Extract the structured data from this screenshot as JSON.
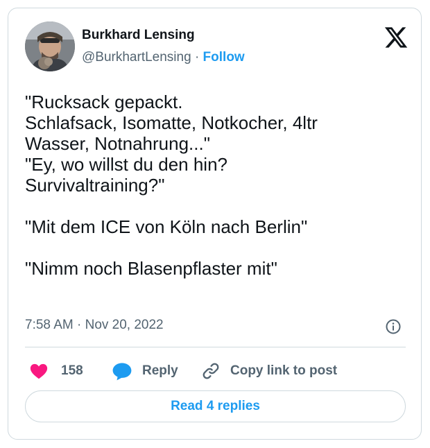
{
  "author": {
    "name": "Burkhard Lensing",
    "handle": "@BurkhartLensing",
    "separator": "·",
    "follow_label": "Follow"
  },
  "tweet": {
    "text": "\"Rucksack gepackt.\nSchlafsack, Isomatte, Notkocher, 4ltr\nWasser, Notnahrung...\"\n\"Ey, wo willst du den hin?\nSurvivaltraining?\"\n\n\"Mit dem ICE von Köln nach Berlin\"\n\n\"Nimm noch Blasenpflaster mit\"",
    "timestamp": "7:58 AM · Nov 20, 2022"
  },
  "actions": {
    "likes_count": "158",
    "reply_label": "Reply",
    "copy_link_label": "Copy link to post"
  },
  "read_replies_label": "Read 4 replies",
  "icons": {
    "brand": "x-logo-icon",
    "info": "info-icon",
    "like": "heart-icon",
    "reply": "speech-bubble-icon",
    "copy": "link-icon"
  },
  "colors": {
    "accent": "#1d9bf0",
    "heart": "#f91880",
    "secondary_text": "#536471",
    "border": "#cfd9de"
  }
}
